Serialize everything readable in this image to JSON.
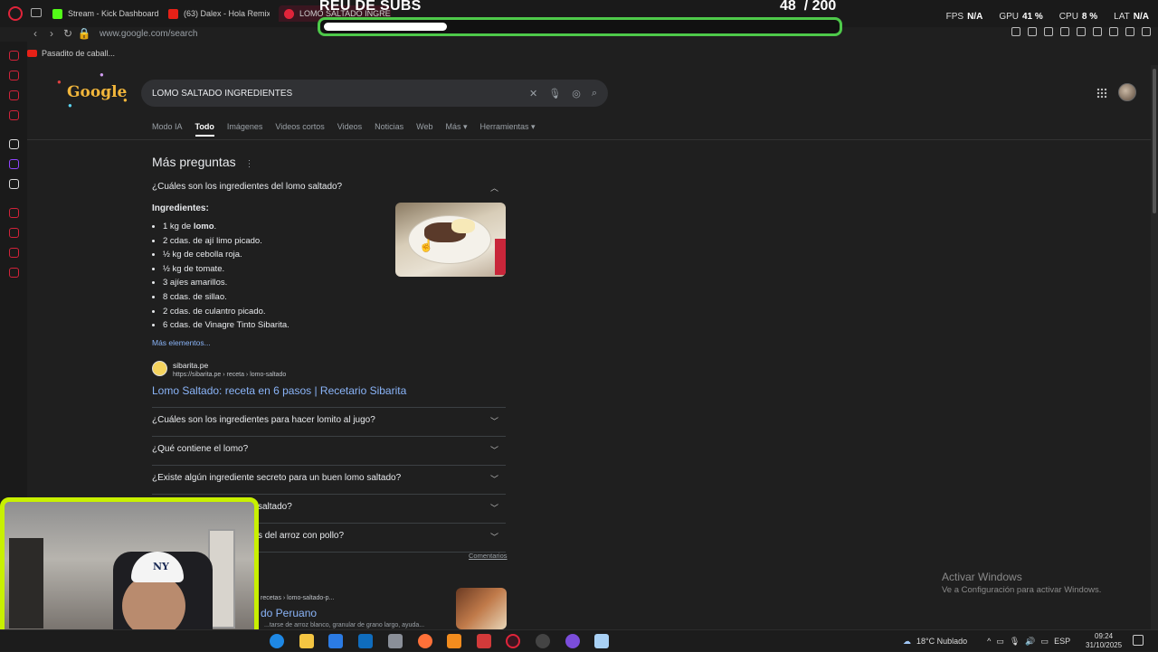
{
  "browser": {
    "tabs": [
      {
        "label": "Stream - Kick Dashboard",
        "color": "#53fc18"
      },
      {
        "label": "(63) Dalex - Hola Remix ft",
        "color": "#e62117"
      },
      {
        "label": "LOMO SALTADO INGRED",
        "color": "#e0243a"
      }
    ],
    "url": "www.google.com/search",
    "bookmark": "Pasadito de caball..."
  },
  "overlay": {
    "title": "REU DE SUBS",
    "count": "48",
    "goal": "/ 200",
    "progress": 0.24,
    "stats": [
      {
        "label": "FPS",
        "value": "N/A"
      },
      {
        "label": "GPU",
        "value": "41 %"
      },
      {
        "label": "CPU",
        "value": "8 %"
      },
      {
        "label": "LAT",
        "value": "N/A"
      }
    ]
  },
  "google": {
    "logo": "Google",
    "query": "LOMO SALTADO INGREDIENTES",
    "tabs": [
      "Modo IA",
      "Todo",
      "Imágenes",
      "Videos cortos",
      "Videos",
      "Noticias",
      "Web",
      "Más ▾",
      "Herramientas ▾"
    ],
    "active_tab": "Todo",
    "paa_title": "Más preguntas",
    "expanded_question": "¿Cuáles son los ingredientes del lomo saltado?",
    "answer_heading": "Ingredientes:",
    "ingredients": [
      "1 kg de lomo.",
      "2 cdas. de ají limo picado.",
      "½ kg de cebolla roja.",
      "½ kg de tomate.",
      "3 ajíes amarillos.",
      "8 cdas. de sillao.",
      "2 cdas. de culantro picado.",
      "6 cdas. de Vinagre Tinto Sibarita."
    ],
    "more_link": "Más elementos...",
    "source_name": "sibarita.pe",
    "source_url": "https://sibarita.pe › receta › lomo-saltado",
    "result_title": "Lomo Saltado: receta en 6 pasos | Recetario Sibarita",
    "questions": [
      "¿Cuáles son los ingredientes para hacer lomito al jugo?",
      "¿Qué contiene el lomo?",
      "¿Existe algún ingrediente secreto para un buen lomo saltado?",
      "saltado?",
      "s del arroz con pollo?"
    ],
    "feedback": "Comentarios",
    "bottom_source": "recetas › lomo-saltado-p...",
    "bottom_title": "do Peruano",
    "bottom_snippet": "...tarse de arroz blanco, granular de grano largo, ayuda..."
  },
  "watermark": {
    "line1": "Activar Windows",
    "line2": "Ve a Configuración para activar Windows."
  },
  "taskbar": {
    "weather": "18°C  Nublado",
    "lang": "ESP",
    "time": "09:24",
    "date": "31/10/2025"
  }
}
